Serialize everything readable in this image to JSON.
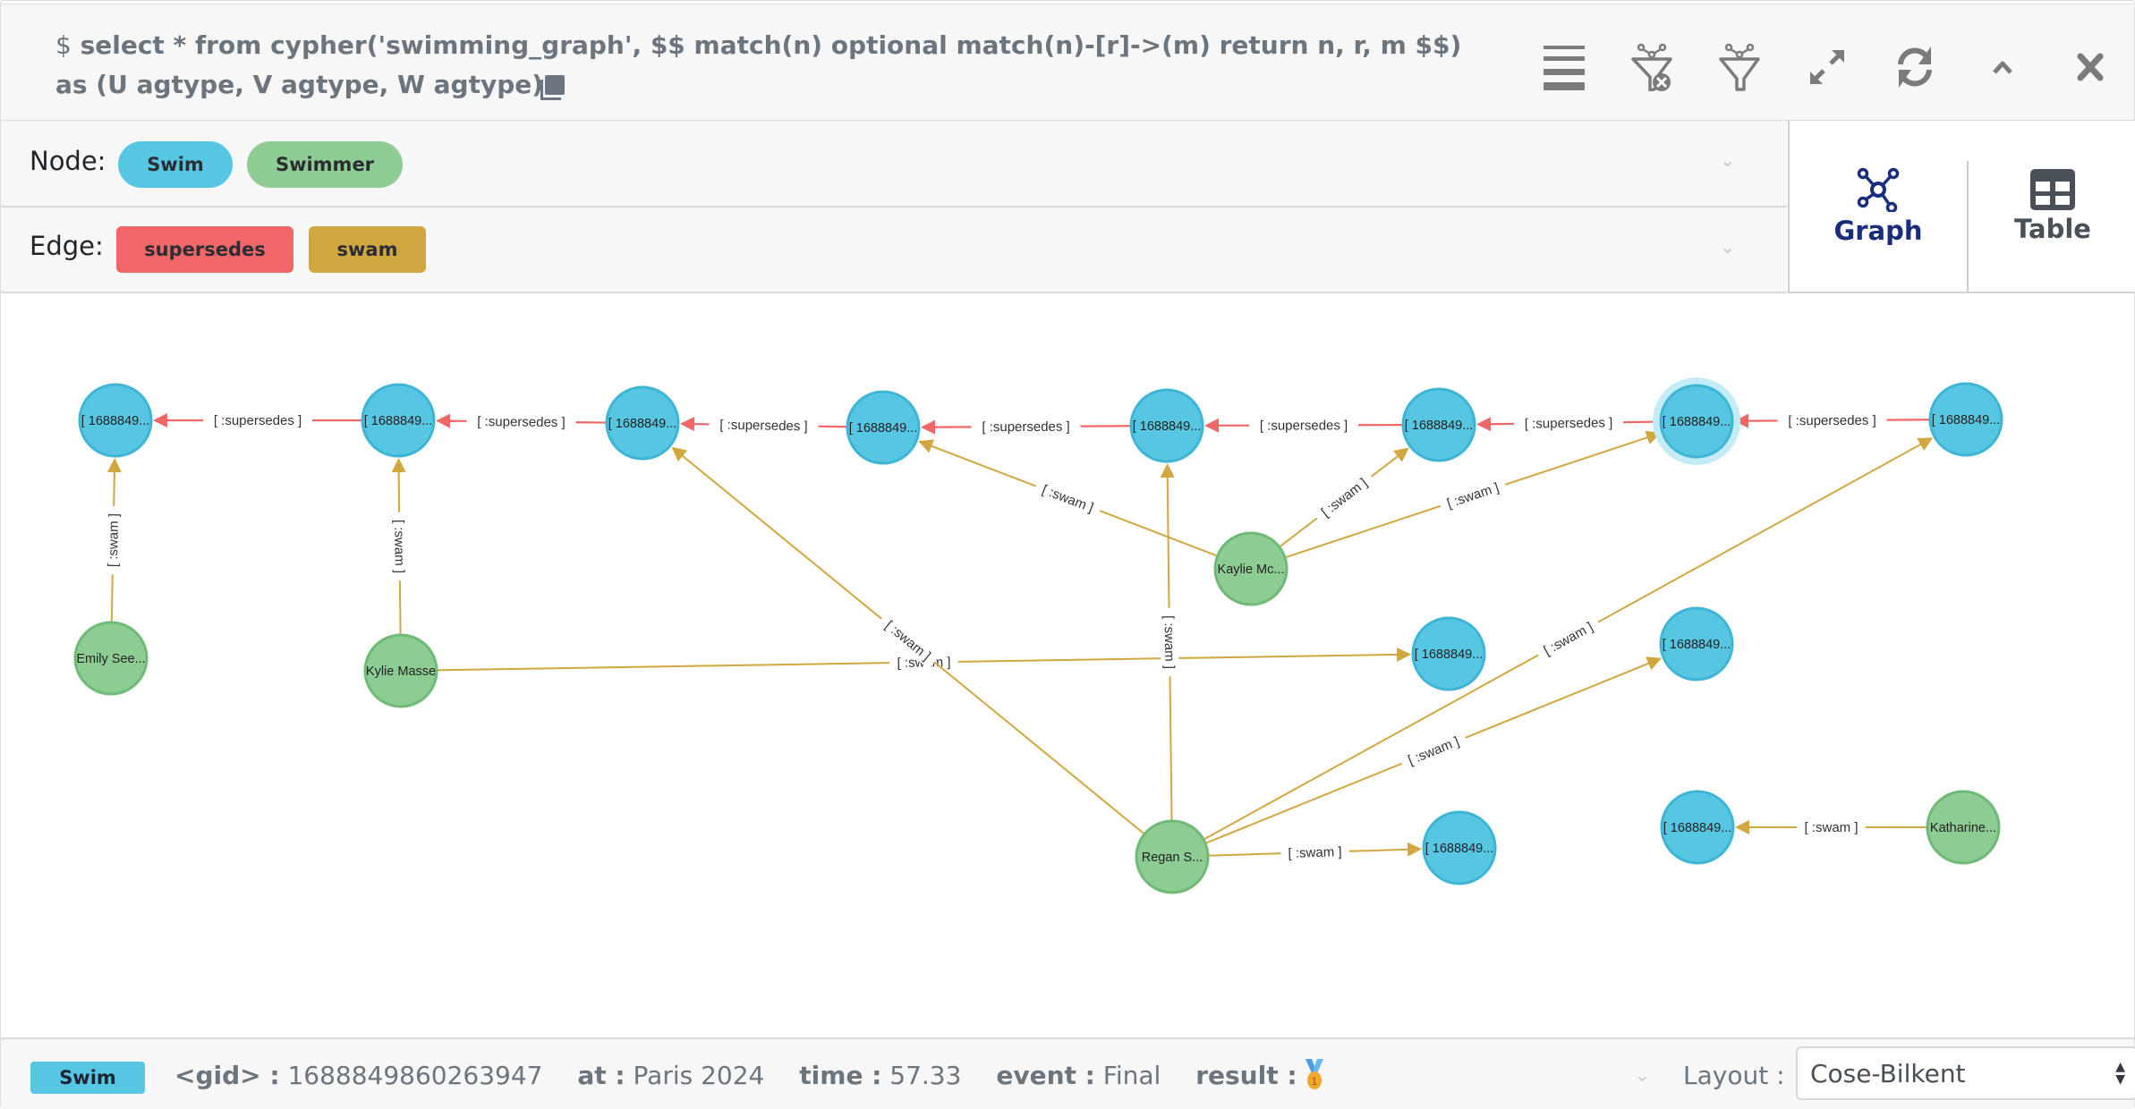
{
  "header": {
    "prompt": "$",
    "query": "select * from cypher('swimming_graph', $$ match(n) optional match(n)-[r]->(m) return n, r, m $$) as (U agtype, V agtype, W agtype)",
    "toolbar": [
      {
        "name": "menu-icon"
      },
      {
        "name": "filter-remove-icon"
      },
      {
        "name": "filter-icon"
      },
      {
        "name": "expand-icon"
      },
      {
        "name": "refresh-icon"
      },
      {
        "name": "collapse-icon"
      },
      {
        "name": "close-icon"
      }
    ]
  },
  "legend": {
    "node_label": "Node:",
    "nodes": [
      {
        "label": "Swim",
        "color": "#57c6e3"
      },
      {
        "label": "Swimmer",
        "color": "#8dcc93"
      }
    ],
    "edge_label": "Edge:",
    "edges": [
      {
        "label": "supersedes",
        "color": "#f16667"
      },
      {
        "label": "swam",
        "color": "#d1a73f"
      }
    ]
  },
  "view_tabs": {
    "graph": "Graph",
    "table": "Table",
    "active": "graph"
  },
  "graph": {
    "nodes": [
      {
        "id": "s1",
        "type": "Swim",
        "label": "[ 1688849..."
      },
      {
        "id": "s2",
        "type": "Swim",
        "label": "[ 1688849..."
      },
      {
        "id": "s3",
        "type": "Swim",
        "label": "[ 1688849..."
      },
      {
        "id": "s4",
        "type": "Swim",
        "label": "[ 1688849..."
      },
      {
        "id": "s5",
        "type": "Swim",
        "label": "[ 1688849..."
      },
      {
        "id": "s6",
        "type": "Swim",
        "label": "[ 1688849..."
      },
      {
        "id": "s7",
        "type": "Swim",
        "label": "[ 1688849...",
        "selected": true
      },
      {
        "id": "s8",
        "type": "Swim",
        "label": "[ 1688849..."
      },
      {
        "id": "s9",
        "type": "Swim",
        "label": "[ 1688849..."
      },
      {
        "id": "s10",
        "type": "Swim",
        "label": "[ 1688849..."
      },
      {
        "id": "s11",
        "type": "Swim",
        "label": "[ 1688849..."
      },
      {
        "id": "s12",
        "type": "Swim",
        "label": "[ 1688849..."
      },
      {
        "id": "p1",
        "type": "Swimmer",
        "label": "Emily See..."
      },
      {
        "id": "p2",
        "type": "Swimmer",
        "label": "Kylie Masse"
      },
      {
        "id": "p3",
        "type": "Swimmer",
        "label": "Kaylie Mc..."
      },
      {
        "id": "p4",
        "type": "Swimmer",
        "label": "Regan S..."
      },
      {
        "id": "p5",
        "type": "Swimmer",
        "label": "Katharine..."
      }
    ],
    "edges": [
      {
        "from": "s2",
        "to": "s1",
        "type": "supersedes",
        "label": "[ :supersedes ]"
      },
      {
        "from": "s3",
        "to": "s2",
        "type": "supersedes",
        "label": "[ :supersedes ]"
      },
      {
        "from": "s4",
        "to": "s3",
        "type": "supersedes",
        "label": "[ :supersedes ]"
      },
      {
        "from": "s5",
        "to": "s4",
        "type": "supersedes",
        "label": "[ :supersedes ]"
      },
      {
        "from": "s6",
        "to": "s5",
        "type": "supersedes",
        "label": "[ :supersedes ]"
      },
      {
        "from": "s7",
        "to": "s6",
        "type": "supersedes",
        "label": "[ :supersedes ]"
      },
      {
        "from": "s8",
        "to": "s7",
        "type": "supersedes",
        "label": "[ :supersedes ]"
      },
      {
        "from": "p1",
        "to": "s1",
        "type": "swam",
        "label": "[ :swam ]"
      },
      {
        "from": "p2",
        "to": "s2",
        "type": "swam",
        "label": "[ :swam ]"
      },
      {
        "from": "p2",
        "to": "s9",
        "type": "swam",
        "label": "[ :swam ]"
      },
      {
        "from": "p3",
        "to": "s4",
        "type": "swam",
        "label": "[ :swam ]"
      },
      {
        "from": "p3",
        "to": "s6",
        "type": "swam",
        "label": "[ :swam ]"
      },
      {
        "from": "p3",
        "to": "s7",
        "type": "swam",
        "label": "[ :swam ]"
      },
      {
        "from": "p4",
        "to": "s3",
        "type": "swam",
        "label": "[ :swam ]"
      },
      {
        "from": "p4",
        "to": "s5",
        "type": "swam",
        "label": "[ :swam ]"
      },
      {
        "from": "p4",
        "to": "s8",
        "type": "swam",
        "label": "[ :swam ]"
      },
      {
        "from": "p4",
        "to": "s10",
        "type": "swam",
        "label": "[ :swam ]"
      },
      {
        "from": "p4",
        "to": "s11",
        "type": "swam",
        "label": "[ :swam ]"
      },
      {
        "from": "p5",
        "to": "s12",
        "type": "swam",
        "label": "[ :swam ]"
      }
    ]
  },
  "footer": {
    "badge": "Swim",
    "props": [
      {
        "key": "<gid> :",
        "value": "1688849860263947"
      },
      {
        "key": "at :",
        "value": "Paris 2024"
      },
      {
        "key": "time :",
        "value": "57.33"
      },
      {
        "key": "event :",
        "value": "Final"
      },
      {
        "key": "result :",
        "value": "",
        "icon": "medal-1st-icon"
      }
    ],
    "layout_label": "Layout :",
    "layout_value": "Cose-Bilkent"
  }
}
